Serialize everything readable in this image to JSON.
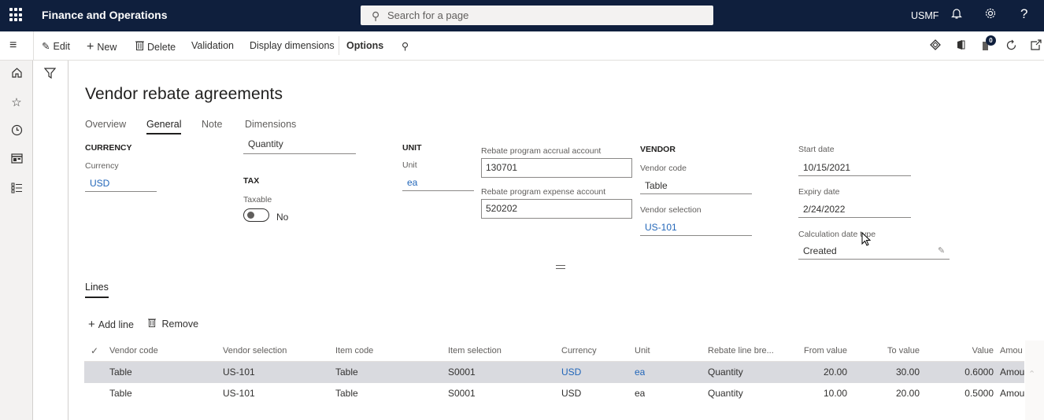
{
  "topbar": {
    "app_title": "Finance and Operations",
    "search_placeholder": "Search for a page",
    "company": "USMF",
    "icons": [
      "waffle-icon",
      "search-icon",
      "bell-icon",
      "gear-icon",
      "help-icon"
    ]
  },
  "actionbar": {
    "edit": "Edit",
    "new": "New",
    "delete": "Delete",
    "validation": "Validation",
    "display_dimensions": "Display dimensions",
    "options": "Options",
    "notification_count": "0",
    "right_icons": [
      "power-apps-icon",
      "office-icon",
      "messages-icon",
      "refresh-icon",
      "open-new-window-icon"
    ]
  },
  "leftnav": {
    "items": [
      "home-icon",
      "star-icon",
      "clock-icon",
      "workspace-icon",
      "list-icon"
    ]
  },
  "page": {
    "title": "Vendor rebate agreements",
    "tabs": [
      {
        "label": "Overview",
        "active": false
      },
      {
        "label": "General",
        "active": true
      },
      {
        "label": "Note",
        "active": false
      },
      {
        "label": "Dimensions",
        "active": false
      }
    ]
  },
  "general": {
    "currency_section": "CURRENCY",
    "currency_label": "Currency",
    "currency_value": "USD",
    "partial_field_value": "Quantity",
    "tax_section": "TAX",
    "taxable_label": "Taxable",
    "taxable_value": "No",
    "taxable_on": false,
    "unit_section": "UNIT",
    "unit_label": "Unit",
    "unit_value": "ea",
    "accrual_label": "Rebate program accrual account",
    "accrual_value": "130701",
    "expense_label": "Rebate program expense account",
    "expense_value": "520202",
    "vendor_section": "VENDOR",
    "vendor_code_label": "Vendor code",
    "vendor_code_value": "Table",
    "vendor_selection_label": "Vendor selection",
    "vendor_selection_value": "US-101",
    "start_date_label": "Start date",
    "start_date_value": "10/15/2021",
    "expiry_date_label": "Expiry date",
    "expiry_date_value": "2/24/2022",
    "calc_date_type_label": "Calculation date type",
    "calc_date_type_value": "Created"
  },
  "lines": {
    "tab_label": "Lines",
    "add_line": "Add line",
    "remove": "Remove",
    "columns": [
      "Vendor code",
      "Vendor selection",
      "Item code",
      "Item selection",
      "Currency",
      "Unit",
      "Rebate line bre...",
      "From value",
      "To value",
      "Value",
      "Amou"
    ],
    "rows": [
      {
        "vendor_code": "Table",
        "vendor_selection": "US-101",
        "item_code": "Table",
        "item_selection": "S0001",
        "currency": "USD",
        "unit": "ea",
        "rebate_line_break": "Quantity",
        "from_value": "20.00",
        "to_value": "30.00",
        "value": "0.6000",
        "amount": "Amou",
        "selected": true
      },
      {
        "vendor_code": "Table",
        "vendor_selection": "US-101",
        "item_code": "Table",
        "item_selection": "S0001",
        "currency": "USD",
        "unit": "ea",
        "rebate_line_break": "Quantity",
        "from_value": "10.00",
        "to_value": "20.00",
        "value": "0.5000",
        "amount": "Amou",
        "selected": false
      }
    ]
  }
}
